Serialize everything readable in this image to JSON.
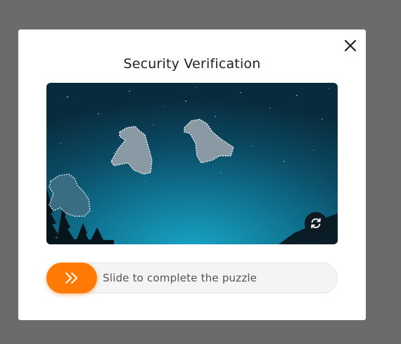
{
  "dialog": {
    "title": "Security Verification",
    "close_icon": "close-icon"
  },
  "puzzle": {
    "image_description_icon": "night-sky-image",
    "refresh_icon": "refresh-icon"
  },
  "slider": {
    "label": "Slide to complete the puzzle",
    "handle_icon": "double-chevron-right-icon",
    "accent_color": "#ff7a05"
  }
}
